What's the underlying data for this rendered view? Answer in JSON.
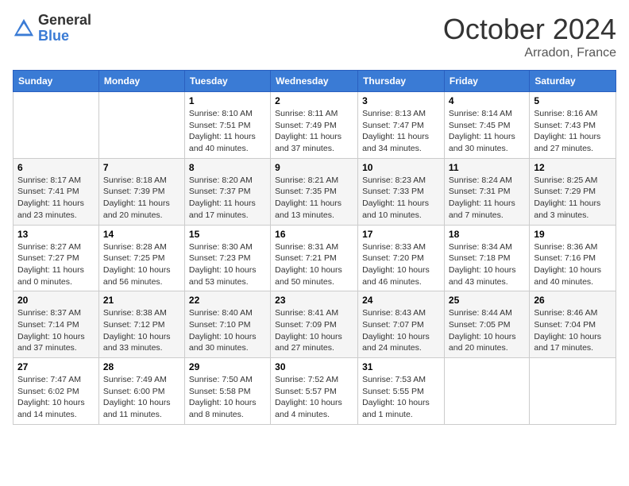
{
  "header": {
    "logo_general": "General",
    "logo_blue": "Blue",
    "month_title": "October 2024",
    "location": "Arradon, France"
  },
  "days_of_week": [
    "Sunday",
    "Monday",
    "Tuesday",
    "Wednesday",
    "Thursday",
    "Friday",
    "Saturday"
  ],
  "weeks": [
    [
      {
        "day": "",
        "info": ""
      },
      {
        "day": "",
        "info": ""
      },
      {
        "day": "1",
        "sunrise": "Sunrise: 8:10 AM",
        "sunset": "Sunset: 7:51 PM",
        "daylight": "Daylight: 11 hours and 40 minutes."
      },
      {
        "day": "2",
        "sunrise": "Sunrise: 8:11 AM",
        "sunset": "Sunset: 7:49 PM",
        "daylight": "Daylight: 11 hours and 37 minutes."
      },
      {
        "day": "3",
        "sunrise": "Sunrise: 8:13 AM",
        "sunset": "Sunset: 7:47 PM",
        "daylight": "Daylight: 11 hours and 34 minutes."
      },
      {
        "day": "4",
        "sunrise": "Sunrise: 8:14 AM",
        "sunset": "Sunset: 7:45 PM",
        "daylight": "Daylight: 11 hours and 30 minutes."
      },
      {
        "day": "5",
        "sunrise": "Sunrise: 8:16 AM",
        "sunset": "Sunset: 7:43 PM",
        "daylight": "Daylight: 11 hours and 27 minutes."
      }
    ],
    [
      {
        "day": "6",
        "sunrise": "Sunrise: 8:17 AM",
        "sunset": "Sunset: 7:41 PM",
        "daylight": "Daylight: 11 hours and 23 minutes."
      },
      {
        "day": "7",
        "sunrise": "Sunrise: 8:18 AM",
        "sunset": "Sunset: 7:39 PM",
        "daylight": "Daylight: 11 hours and 20 minutes."
      },
      {
        "day": "8",
        "sunrise": "Sunrise: 8:20 AM",
        "sunset": "Sunset: 7:37 PM",
        "daylight": "Daylight: 11 hours and 17 minutes."
      },
      {
        "day": "9",
        "sunrise": "Sunrise: 8:21 AM",
        "sunset": "Sunset: 7:35 PM",
        "daylight": "Daylight: 11 hours and 13 minutes."
      },
      {
        "day": "10",
        "sunrise": "Sunrise: 8:23 AM",
        "sunset": "Sunset: 7:33 PM",
        "daylight": "Daylight: 11 hours and 10 minutes."
      },
      {
        "day": "11",
        "sunrise": "Sunrise: 8:24 AM",
        "sunset": "Sunset: 7:31 PM",
        "daylight": "Daylight: 11 hours and 7 minutes."
      },
      {
        "day": "12",
        "sunrise": "Sunrise: 8:25 AM",
        "sunset": "Sunset: 7:29 PM",
        "daylight": "Daylight: 11 hours and 3 minutes."
      }
    ],
    [
      {
        "day": "13",
        "sunrise": "Sunrise: 8:27 AM",
        "sunset": "Sunset: 7:27 PM",
        "daylight": "Daylight: 11 hours and 0 minutes."
      },
      {
        "day": "14",
        "sunrise": "Sunrise: 8:28 AM",
        "sunset": "Sunset: 7:25 PM",
        "daylight": "Daylight: 10 hours and 56 minutes."
      },
      {
        "day": "15",
        "sunrise": "Sunrise: 8:30 AM",
        "sunset": "Sunset: 7:23 PM",
        "daylight": "Daylight: 10 hours and 53 minutes."
      },
      {
        "day": "16",
        "sunrise": "Sunrise: 8:31 AM",
        "sunset": "Sunset: 7:21 PM",
        "daylight": "Daylight: 10 hours and 50 minutes."
      },
      {
        "day": "17",
        "sunrise": "Sunrise: 8:33 AM",
        "sunset": "Sunset: 7:20 PM",
        "daylight": "Daylight: 10 hours and 46 minutes."
      },
      {
        "day": "18",
        "sunrise": "Sunrise: 8:34 AM",
        "sunset": "Sunset: 7:18 PM",
        "daylight": "Daylight: 10 hours and 43 minutes."
      },
      {
        "day": "19",
        "sunrise": "Sunrise: 8:36 AM",
        "sunset": "Sunset: 7:16 PM",
        "daylight": "Daylight: 10 hours and 40 minutes."
      }
    ],
    [
      {
        "day": "20",
        "sunrise": "Sunrise: 8:37 AM",
        "sunset": "Sunset: 7:14 PM",
        "daylight": "Daylight: 10 hours and 37 minutes."
      },
      {
        "day": "21",
        "sunrise": "Sunrise: 8:38 AM",
        "sunset": "Sunset: 7:12 PM",
        "daylight": "Daylight: 10 hours and 33 minutes."
      },
      {
        "day": "22",
        "sunrise": "Sunrise: 8:40 AM",
        "sunset": "Sunset: 7:10 PM",
        "daylight": "Daylight: 10 hours and 30 minutes."
      },
      {
        "day": "23",
        "sunrise": "Sunrise: 8:41 AM",
        "sunset": "Sunset: 7:09 PM",
        "daylight": "Daylight: 10 hours and 27 minutes."
      },
      {
        "day": "24",
        "sunrise": "Sunrise: 8:43 AM",
        "sunset": "Sunset: 7:07 PM",
        "daylight": "Daylight: 10 hours and 24 minutes."
      },
      {
        "day": "25",
        "sunrise": "Sunrise: 8:44 AM",
        "sunset": "Sunset: 7:05 PM",
        "daylight": "Daylight: 10 hours and 20 minutes."
      },
      {
        "day": "26",
        "sunrise": "Sunrise: 8:46 AM",
        "sunset": "Sunset: 7:04 PM",
        "daylight": "Daylight: 10 hours and 17 minutes."
      }
    ],
    [
      {
        "day": "27",
        "sunrise": "Sunrise: 7:47 AM",
        "sunset": "Sunset: 6:02 PM",
        "daylight": "Daylight: 10 hours and 14 minutes."
      },
      {
        "day": "28",
        "sunrise": "Sunrise: 7:49 AM",
        "sunset": "Sunset: 6:00 PM",
        "daylight": "Daylight: 10 hours and 11 minutes."
      },
      {
        "day": "29",
        "sunrise": "Sunrise: 7:50 AM",
        "sunset": "Sunset: 5:58 PM",
        "daylight": "Daylight: 10 hours and 8 minutes."
      },
      {
        "day": "30",
        "sunrise": "Sunrise: 7:52 AM",
        "sunset": "Sunset: 5:57 PM",
        "daylight": "Daylight: 10 hours and 4 minutes."
      },
      {
        "day": "31",
        "sunrise": "Sunrise: 7:53 AM",
        "sunset": "Sunset: 5:55 PM",
        "daylight": "Daylight: 10 hours and 1 minute."
      },
      {
        "day": "",
        "info": ""
      },
      {
        "day": "",
        "info": ""
      }
    ]
  ]
}
